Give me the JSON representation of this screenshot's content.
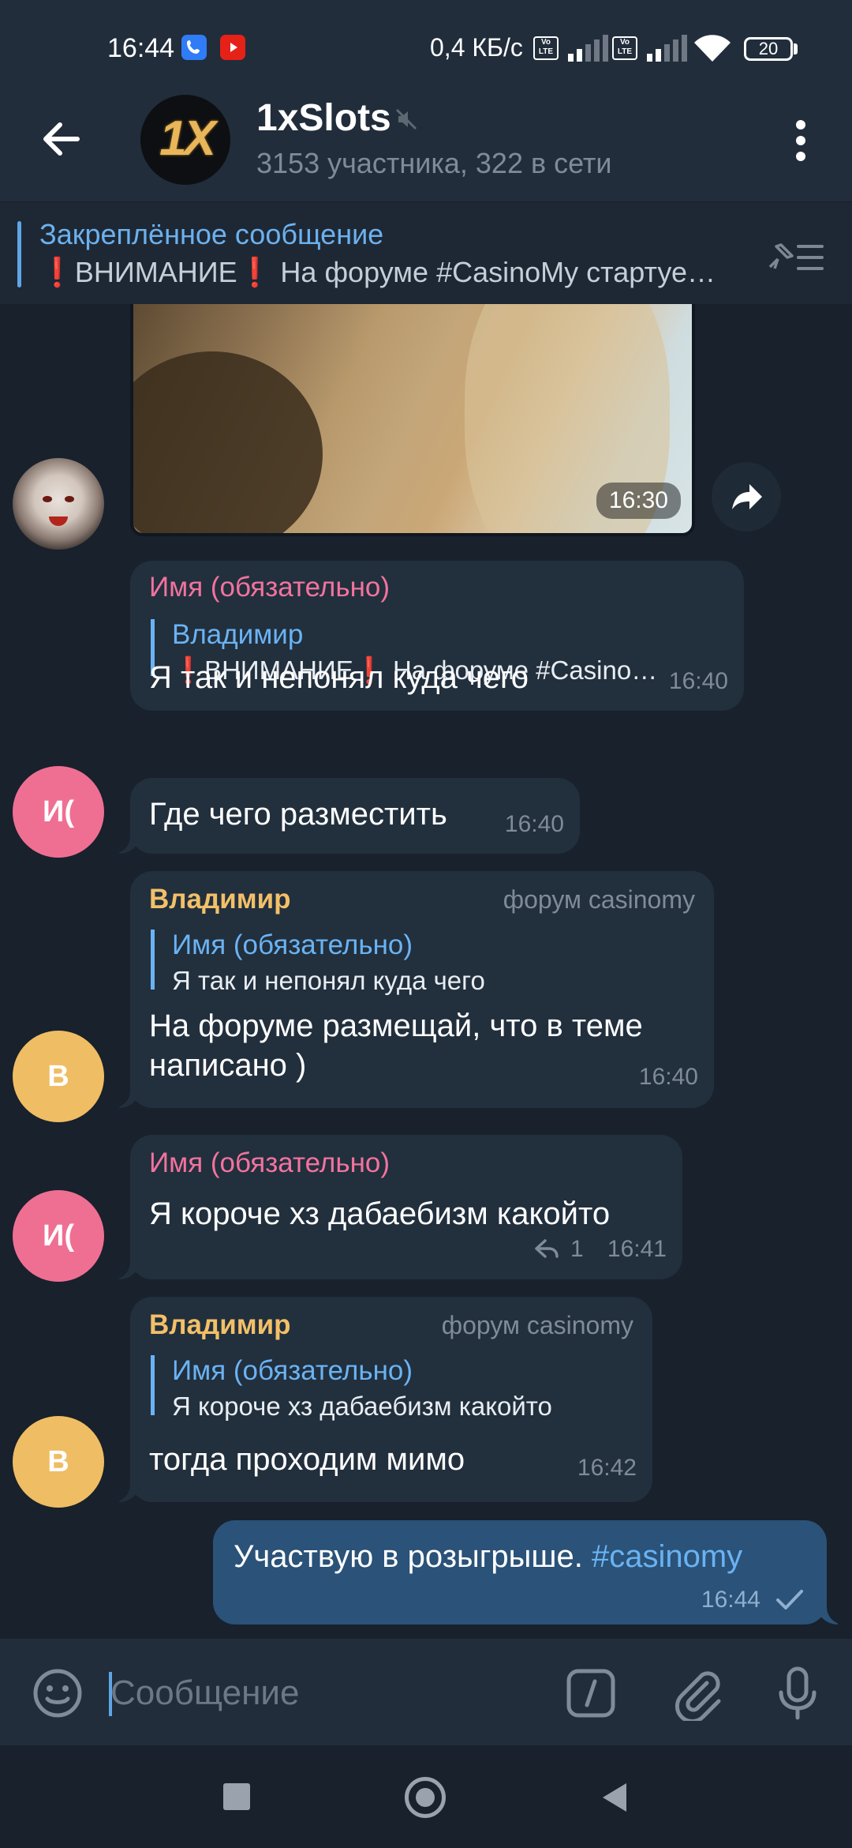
{
  "status_bar": {
    "time": "16:44",
    "network_speed": "0,4 КБ/с",
    "lte_label": "Vo LTE",
    "battery": "20"
  },
  "header": {
    "title": "1xSlots",
    "subtitle": "3153 участника, 322 в сети",
    "avatar_text": "1X"
  },
  "pinned": {
    "title": "Закреплённое сообщение",
    "text": "❗ВНИМАНИЕ❗ На форуме #CasinoMy стартуе…"
  },
  "messages": [
    {
      "type": "media",
      "time": "16:30"
    },
    {
      "sender": "Имя (обязательно)",
      "reply_name": "Владимир",
      "reply_text": "❗ВНИМАНИЕ❗ На форуме #Casino…",
      "text": "Я так и непонял куда чего",
      "time": "16:40"
    },
    {
      "text": "Где чего разместить",
      "time": "16:40",
      "avatar": "И("
    },
    {
      "sender": "Владимир",
      "role": "форум casinomy",
      "reply_name": "Имя (обязательно)",
      "reply_text": "Я так и непонял куда чего",
      "text_line1": "На форуме размещай, что в теме",
      "text_line2": "написано )",
      "time": "16:40",
      "avatar": "В"
    },
    {
      "sender": "Имя (обязательно)",
      "text": "Я короче хз дабаебизм какойто",
      "replies": "1",
      "time": "16:41",
      "avatar": "И("
    },
    {
      "sender": "Владимир",
      "role": "форум casinomy",
      "reply_name": "Имя (обязательно)",
      "reply_text": "Я короче хз дабаебизм какойто",
      "text": "тогда проходим мимо",
      "time": "16:42",
      "avatar": "В"
    },
    {
      "text": "Участвую в розыгрыше.",
      "hashtag": "#casinomy",
      "time": "16:44"
    }
  ],
  "input": {
    "placeholder": "Сообщение"
  },
  "colors": {
    "name_pink": "#f2739e",
    "name_orange": "#f2c068",
    "avatar_pink": "#ef6f93",
    "avatar_yellow": "#efbd63",
    "link_blue": "#6ab3f3"
  }
}
